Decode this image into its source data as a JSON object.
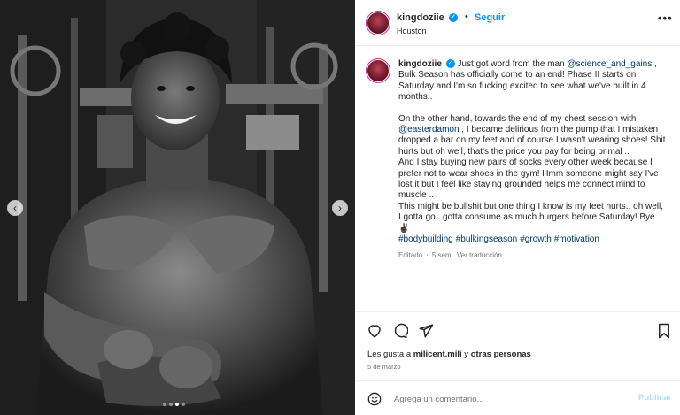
{
  "post": {
    "username": "kingdoziie",
    "follow_label": "Seguir",
    "separator": "•",
    "location": "Houston",
    "more_label": "•••"
  },
  "caption": {
    "username": "kingdoziie",
    "p1_a": "Just got word from the man ",
    "p1_mention": "@science_and_gains",
    "p1_b": " , Bulk Season has officially come to an end! Phase II starts on Saturday and I'm so fucking excited to see what we've built in 4 months..",
    "p2_a": "On the other hand, towards the end of my chest session with ",
    "p2_mention": "@easterdamon",
    "p2_b": " , I became delirious from the pump that I mistaken dropped a bar on my feet and of course I wasn't wearing shoes! Shit hurts but oh well, that's the price you pay for being primal ..",
    "p3": "And I stay buying new pairs of socks every other week because I prefer not to wear shoes in the gym! Hmm someone might say I've lost it but I feel like staying grounded helps me connect mind to muscle ..",
    "p4": "This might be bullshit but one thing I know is my feet hurts.. oh well, I gotta go.. gotta consume as much burgers before Saturday! Bye ✌🏿",
    "hashtags": [
      "#bodybuilding",
      "#bulkingseason",
      "#growth",
      "#motivation"
    ],
    "edited": "Editado",
    "time_ago": "5 sem",
    "translation": "Ver traducción"
  },
  "likes": {
    "prefix": "Les gusta a ",
    "user": "milicent.mili",
    "middle": " y ",
    "others": "otras personas"
  },
  "date": "5 de marzo",
  "comment": {
    "placeholder": "Agrega un comentario...",
    "publish_label": "Publicar"
  },
  "carousel": {
    "prev_label": "‹",
    "next_label": "›",
    "dot_count": 4,
    "active_dot": 2
  },
  "colors": {
    "accent": "#0095f6",
    "link": "#00376b",
    "muted": "#737373",
    "publish_disabled": "#b2dffc"
  },
  "icons": [
    "heart-icon",
    "comment-icon",
    "share-icon",
    "bookmark-icon",
    "emoji-icon",
    "verified-icon",
    "more-icon"
  ]
}
